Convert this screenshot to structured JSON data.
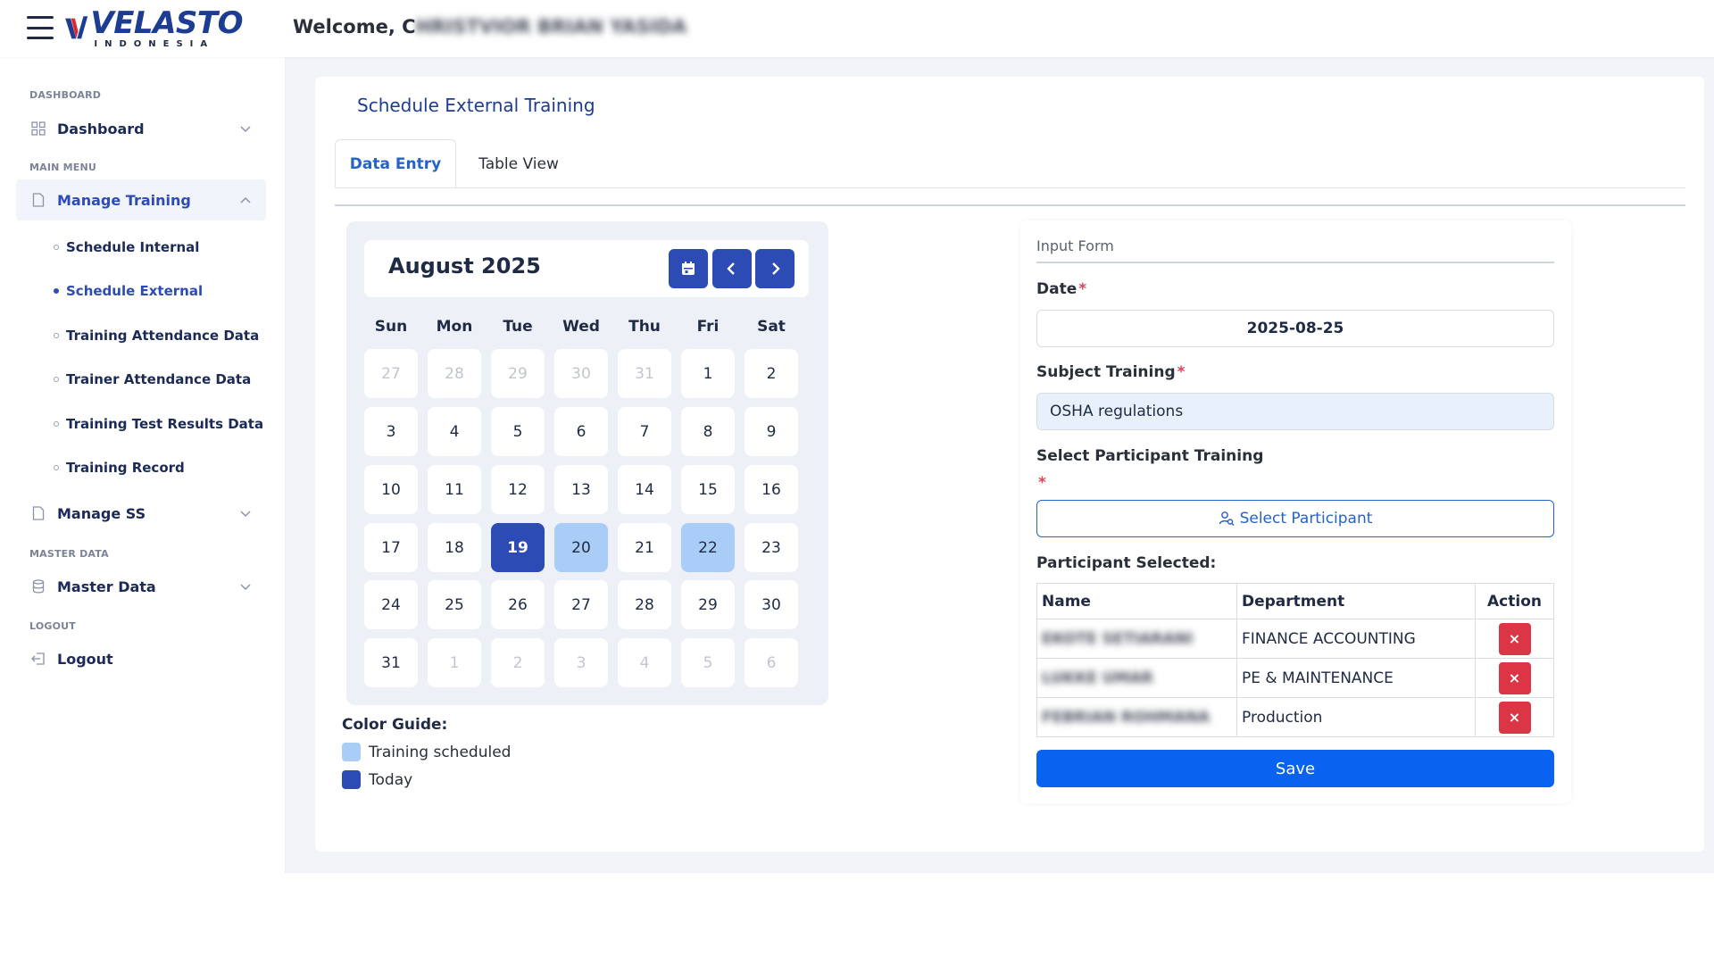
{
  "header": {
    "welcome_prefix": "Welcome, C",
    "welcome_name_blurred": "HRISTVIOR BRIAN YASIDA",
    "logo_word": "VELASTO",
    "logo_sub": "INDONESIA"
  },
  "sidebar": {
    "sections": {
      "dashboard": "DASHBOARD",
      "main_menu": "MAIN MENU",
      "master_data": "MASTER DATA",
      "logout": "LOGOUT"
    },
    "dashboard": "Dashboard",
    "manage_training": "Manage Training",
    "sub_items": [
      "Schedule Internal",
      "Schedule External",
      "Training Attendance Data",
      "Trainer Attendance Data",
      "Training Test Results Data",
      "Training Record"
    ],
    "manage_ss": "Manage SS",
    "master_data": "Master Data",
    "logout": "Logout"
  },
  "page": {
    "title": "Schedule External Training",
    "tabs": [
      "Data Entry",
      "Table View"
    ],
    "active_tab": "Data Entry"
  },
  "calendar": {
    "title": "August 2025",
    "weekdays": [
      "Sun",
      "Mon",
      "Tue",
      "Wed",
      "Thu",
      "Fri",
      "Sat"
    ],
    "days": [
      "27",
      "28",
      "29",
      "30",
      "31",
      "1",
      "2",
      "3",
      "4",
      "5",
      "6",
      "7",
      "8",
      "9",
      "10",
      "11",
      "12",
      "13",
      "14",
      "15",
      "16",
      "17",
      "18",
      "19",
      "20",
      "21",
      "22",
      "23",
      "24",
      "25",
      "26",
      "27",
      "28",
      "29",
      "30",
      "31",
      "1",
      "2",
      "3",
      "4",
      "5",
      "6"
    ],
    "today": "19",
    "scheduled": [
      "20",
      "22"
    ],
    "colors": {
      "scheduled": "#a9cdf7",
      "today": "#2d4bb4"
    }
  },
  "guide": {
    "title": "Color Guide:",
    "scheduled": "Training scheduled",
    "today": "Today"
  },
  "form": {
    "heading": "Input Form",
    "date_label": "Date",
    "date_value": "2025-08-25",
    "subject_label": "Subject Training",
    "subject_value": "OSHA regulations",
    "participant_label": "Select Participant Training",
    "select_button": "Select Participant",
    "selected_label": "Participant Selected:",
    "columns": [
      "Name",
      "Department",
      "Action"
    ],
    "participants": [
      {
        "name": "EKOTE SETIARANI",
        "department": "FINANCE ACCOUNTING"
      },
      {
        "name": "LUKKE UMAR",
        "department": "PE & MAINTENANCE"
      },
      {
        "name": "FEBRIAN ROHMANA",
        "department": "Production"
      }
    ],
    "delete_symbol": "×",
    "save_button": "Save"
  }
}
